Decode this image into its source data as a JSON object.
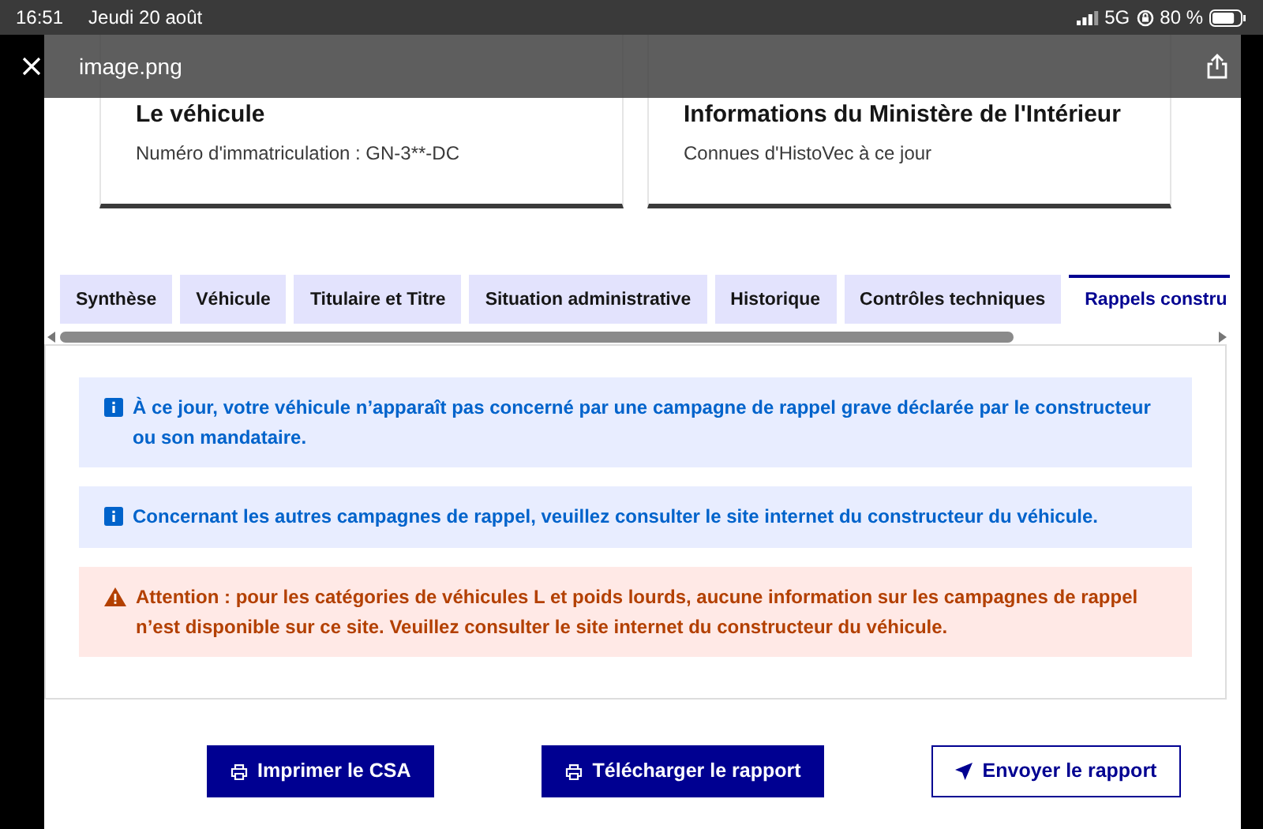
{
  "status_bar": {
    "time": "16:51",
    "date": "Jeudi 20 août",
    "network": "5G",
    "battery": "80 %"
  },
  "viewer": {
    "title": "image.png"
  },
  "cards": [
    {
      "title": "Le véhicule",
      "text": "Numéro d'immatriculation : GN-3**-DC"
    },
    {
      "title": "Informations du Ministère de l'Intérieur",
      "text": "Connues d'HistoVec à ce jour"
    }
  ],
  "tabs": [
    {
      "label": "Synthèse",
      "selected": false
    },
    {
      "label": "Véhicule",
      "selected": false
    },
    {
      "label": "Titulaire et Titre",
      "selected": false
    },
    {
      "label": "Situation administrative",
      "selected": false
    },
    {
      "label": "Historique",
      "selected": false
    },
    {
      "label": "Contrôles techniques",
      "selected": false
    },
    {
      "label": "Rappels constru",
      "selected": true
    }
  ],
  "alerts": [
    {
      "kind": "info",
      "text": "À ce jour, votre véhicule n’apparaît pas concerné par une campagne de rappel grave déclarée par le constructeur ou son mandataire."
    },
    {
      "kind": "info",
      "text": "Concernant les autres campagnes de rappel, veuillez consulter le site internet du constructeur du véhicule."
    },
    {
      "kind": "warning",
      "text": "Attention : pour les catégories de véhicules L et poids lourds, aucune information sur les campagnes de rappel n’est disponible sur ce site. Veuillez consulter le site internet du constructeur du véhicule."
    }
  ],
  "buttons": [
    {
      "label": "Imprimer le CSA",
      "kind": "print"
    },
    {
      "label": "Télécharger le rapport",
      "kind": "print"
    },
    {
      "label": "Envoyer le rapport",
      "kind": "send"
    }
  ]
}
